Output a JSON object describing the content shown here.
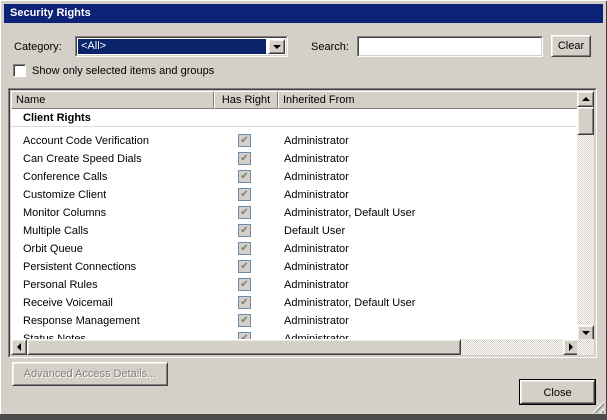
{
  "window": {
    "title": "Security Rights"
  },
  "filters": {
    "category_label": "Category:",
    "category_value": "<All>",
    "search_label": "Search:",
    "search_value": "",
    "clear_button": "Clear",
    "show_only_label": "Show only selected items and groups",
    "show_only_checked": false
  },
  "table": {
    "columns": [
      "Name",
      "Has Right",
      "Inherited From"
    ],
    "group": "Client Rights",
    "rows": [
      {
        "name": "Account Code Verification",
        "has_right": true,
        "inherited_from": "Administrator"
      },
      {
        "name": "Can Create Speed Dials",
        "has_right": true,
        "inherited_from": "Administrator"
      },
      {
        "name": "Conference Calls",
        "has_right": true,
        "inherited_from": "Administrator"
      },
      {
        "name": "Customize Client",
        "has_right": true,
        "inherited_from": "Administrator"
      },
      {
        "name": "Monitor Columns",
        "has_right": true,
        "inherited_from": "Administrator, Default User"
      },
      {
        "name": "Multiple Calls",
        "has_right": true,
        "inherited_from": "Default User"
      },
      {
        "name": "Orbit Queue",
        "has_right": true,
        "inherited_from": "Administrator"
      },
      {
        "name": "Persistent Connections",
        "has_right": true,
        "inherited_from": "Administrator"
      },
      {
        "name": "Personal Rules",
        "has_right": true,
        "inherited_from": "Administrator"
      },
      {
        "name": "Receive Voicemail",
        "has_right": true,
        "inherited_from": "Administrator, Default User"
      },
      {
        "name": "Response Management",
        "has_right": true,
        "inherited_from": "Administrator"
      },
      {
        "name": "Status Notes",
        "has_right": true,
        "inherited_from": "Administrator"
      }
    ]
  },
  "footer": {
    "advanced_button": "Advanced Access Details...",
    "close_button": "Close"
  },
  "colors": {
    "titlebar": "#0d2377",
    "selection": "#0a246a",
    "dialog_bg": "#d4d0c8"
  }
}
